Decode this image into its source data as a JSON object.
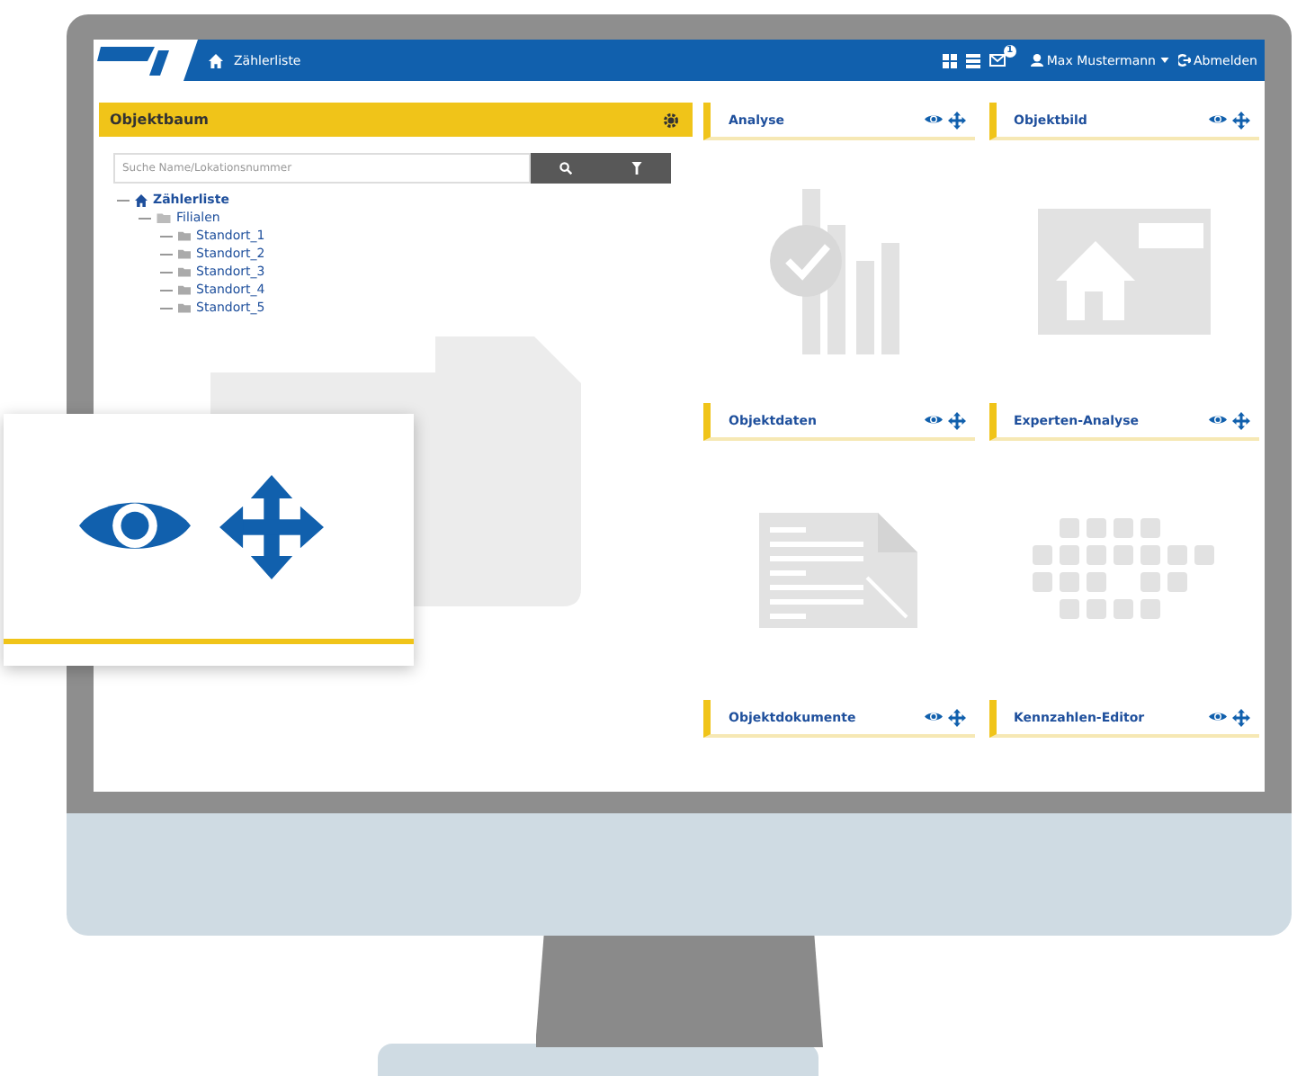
{
  "nav": {
    "breadcrumb": "Zählerliste",
    "badge": "1",
    "user": "Max Mustermann",
    "logout": "Abmelden"
  },
  "tree_panel": {
    "title": "Objektbaum",
    "search": {
      "placeholder": "Suche Name/Lokationsnummer"
    },
    "tree": [
      {
        "label": "Zählerliste",
        "kind": "root",
        "children": [
          {
            "label": "Filialen",
            "kind": "folder",
            "children": [
              {
                "label": "Standort_1",
                "kind": "leaf"
              },
              {
                "label": "Standort_2",
                "kind": "leaf"
              },
              {
                "label": "Standort_3",
                "kind": "leaf"
              },
              {
                "label": "Standort_4",
                "kind": "leaf"
              },
              {
                "label": "Standort_5",
                "kind": "leaf"
              }
            ]
          }
        ]
      }
    ]
  },
  "widgets": [
    {
      "title": "Analyse",
      "kind": "chart"
    },
    {
      "title": "Objektbild",
      "kind": "house"
    },
    {
      "title": "Objektdaten",
      "kind": "document"
    },
    {
      "title": "Experten-Analyse",
      "kind": "grid"
    },
    {
      "title": "Objektdokumente",
      "kind": "none"
    },
    {
      "title": "Kennzahlen-Editor",
      "kind": "none"
    }
  ]
}
